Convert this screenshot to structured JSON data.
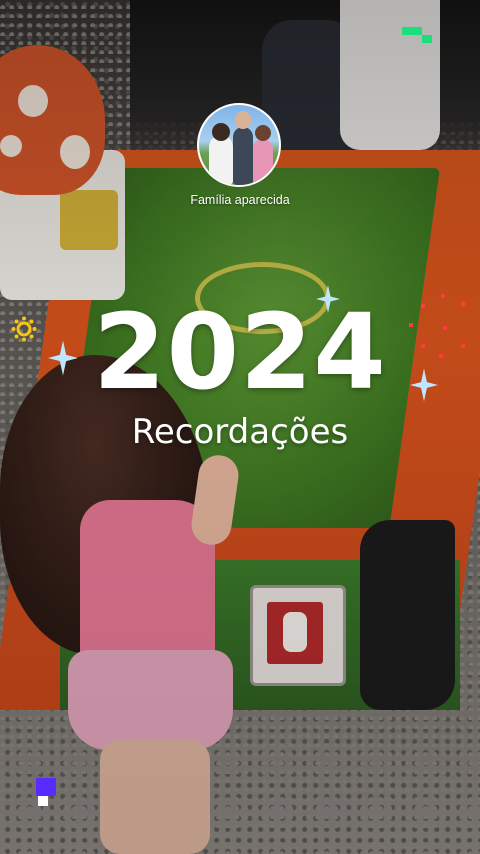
{
  "memory": {
    "avatar_label": "Família aparecida",
    "year": "2024",
    "subtitle": "Recordações"
  },
  "colors": {
    "text": "#ffffff",
    "sparkle": "#bfe6ff",
    "accent_green": "#19e07a",
    "accent_purple": "#5a2bff",
    "accent_red": "#ff3b3b",
    "accent_yellow": "#f5c518"
  },
  "icons": [
    "avatar-photo",
    "sparkle-icon",
    "sun-icon",
    "dots-icon",
    "pixel-green-icon",
    "pixel-purple-icon"
  ]
}
